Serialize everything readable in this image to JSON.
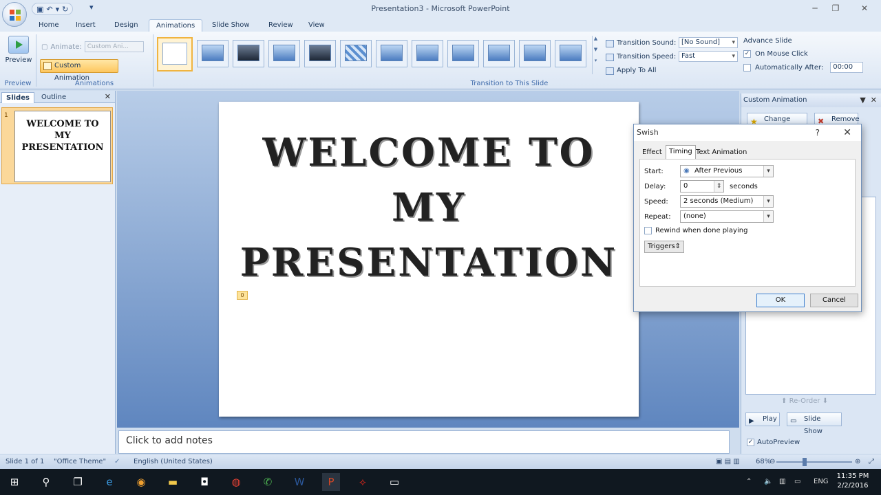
{
  "window": {
    "title": "Presentation3 - Microsoft PowerPoint",
    "qat_icons": [
      "save-icon",
      "undo-icon",
      "redo-icon"
    ]
  },
  "ribbon": {
    "tabs": [
      "Home",
      "Insert",
      "Design",
      "Animations",
      "Slide Show",
      "Review",
      "View"
    ],
    "active_tab": "Animations",
    "preview": {
      "label": "Preview",
      "group": "Preview"
    },
    "animations": {
      "animate_label": "Animate:",
      "animate_value": "Custom Ani...",
      "custom_animation": "Custom Animation",
      "group": "Animations"
    },
    "transitions": {
      "group": "Transition to This Slide",
      "sound_label": "Transition Sound:",
      "sound_value": "[No Sound]",
      "speed_label": "Transition Speed:",
      "speed_value": "Fast",
      "apply_all": "Apply To All"
    },
    "advance": {
      "heading": "Advance Slide",
      "on_click": "On Mouse Click",
      "on_click_checked": true,
      "after": "Automatically After:",
      "after_value": "00:00"
    }
  },
  "left_pane": {
    "tabs": [
      "Slides",
      "Outline"
    ],
    "slide_number": "1",
    "thumb_lines": [
      "WELCOME TO",
      "MY",
      "PRESENTATION"
    ]
  },
  "slide": {
    "title_lines": [
      "WELCOME TO",
      "MY",
      "PRESENTATION"
    ],
    "anim_tag": "0"
  },
  "notes": {
    "placeholder": "Click to add notes"
  },
  "task_pane": {
    "title": "Custom Animation",
    "change": "Change",
    "remove": "Remove",
    "reorder": "Re-Order",
    "play": "Play",
    "slide_show": "Slide Show",
    "autopreview": "AutoPreview",
    "autopreview_checked": true
  },
  "dialog": {
    "title": "Swish",
    "tabs": [
      "Effect",
      "Timing",
      "Text Animation"
    ],
    "active_tab": "Timing",
    "start_label": "Start:",
    "start_value": "After Previous",
    "delay_label": "Delay:",
    "delay_value": "0",
    "delay_unit": "seconds",
    "speed_label": "Speed:",
    "speed_value": "2 seconds (Medium)",
    "repeat_label": "Repeat:",
    "repeat_value": "(none)",
    "rewind_label": "Rewind when done playing",
    "rewind_checked": false,
    "triggers": "Triggers",
    "ok": "OK",
    "cancel": "Cancel"
  },
  "status": {
    "slide": "Slide 1 of 1",
    "theme": "\"Office Theme\"",
    "language": "English (United States)",
    "zoom": "68%"
  },
  "taskbar": {
    "lang": "ENG",
    "time": "11:35 PM",
    "date": "2/2/2016"
  }
}
